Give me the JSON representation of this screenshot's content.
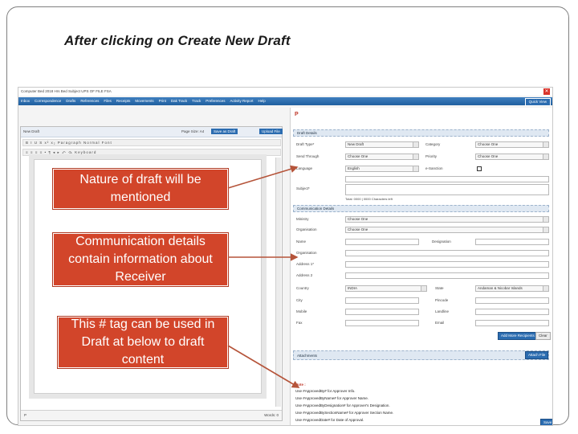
{
  "slide": {
    "title": "After clicking on Create New Draft"
  },
  "app": {
    "header_text": "Computer Bed 2018  Hrs Bed  Subject UPS OF FILE  FSA",
    "menu_items": [
      "Inbox",
      "Correspondence",
      "Drafts",
      "References",
      "Files",
      "Receipts",
      "Movements",
      "Print",
      "Dak Track",
      "Track",
      "Preferences",
      "Activity Report",
      "Help"
    ],
    "quick_view": "Quick View"
  },
  "editor": {
    "title": "New Draft",
    "page_size": "Page Size: A4",
    "send_btn": "Save as Draft",
    "upload_btn": "Upload File",
    "toolbar_row1": "B I U S  x²  x₂  Paragraph  Normal  Font",
    "toolbar_row2": "≡ ≡ ≡ ≡  • ¶  ◂ ▸  ⤺ ⤼  Keyboard",
    "footer_left": "P",
    "footer_right": "Words: 0"
  },
  "draft_details": {
    "header": "Draft Details",
    "labels": {
      "draft_type": "Draft Type*",
      "send_to": "Send Through",
      "language": "Language",
      "subject": "Subject*",
      "category": "Category",
      "priority": "Priority",
      "sanction": "e-Sanction"
    },
    "values": {
      "draft_type": "New Draft",
      "send_to": "Choose One",
      "language": "English",
      "category": "Choose One",
      "priority": "Choose One"
    },
    "char_hint": "Total: 0000  |  0000  Characters left"
  },
  "communication": {
    "header": "Communication Details",
    "labels": {
      "ministry": "Ministry",
      "organisation": "Organisation",
      "name": "Name",
      "designation": "Designation",
      "org_section": "Organisation",
      "address1": "Address 1*",
      "address2": "Address 2",
      "country": "Country",
      "state": "State",
      "city": "City",
      "pincode": "Pincode",
      "mobile": "Mobile",
      "landline": "Landline",
      "fax": "Fax",
      "email": "Email"
    },
    "values": {
      "ministry": "Choose One",
      "organisation": "Choose One",
      "country": "INDIA",
      "state": "Andaman & Nicobar Islands"
    },
    "add_btn": "Add More Recipients",
    "clear_btn": "Clear"
  },
  "attachments": {
    "header": "Attachments",
    "attach_btn": "Attach File"
  },
  "notes": {
    "title": "Note :",
    "lines": [
      "Use #ApprovedBy# for Approver Info.",
      "Use #ApprovedByName# for Approver Name.",
      "Use #ApprovedByDesignation# for Approver's Designation.",
      "Use #ApprovedBySectionName# for Approver Section Name.",
      "Use #ApprovedDate# for Date of Approval."
    ]
  },
  "footer_btn": "Save",
  "callouts": {
    "nature": "Nature of draft will be mentioned",
    "communication": "Communication details contain information about Receiver",
    "hashtag": "This # tag can be used in Draft at below to draft content"
  }
}
